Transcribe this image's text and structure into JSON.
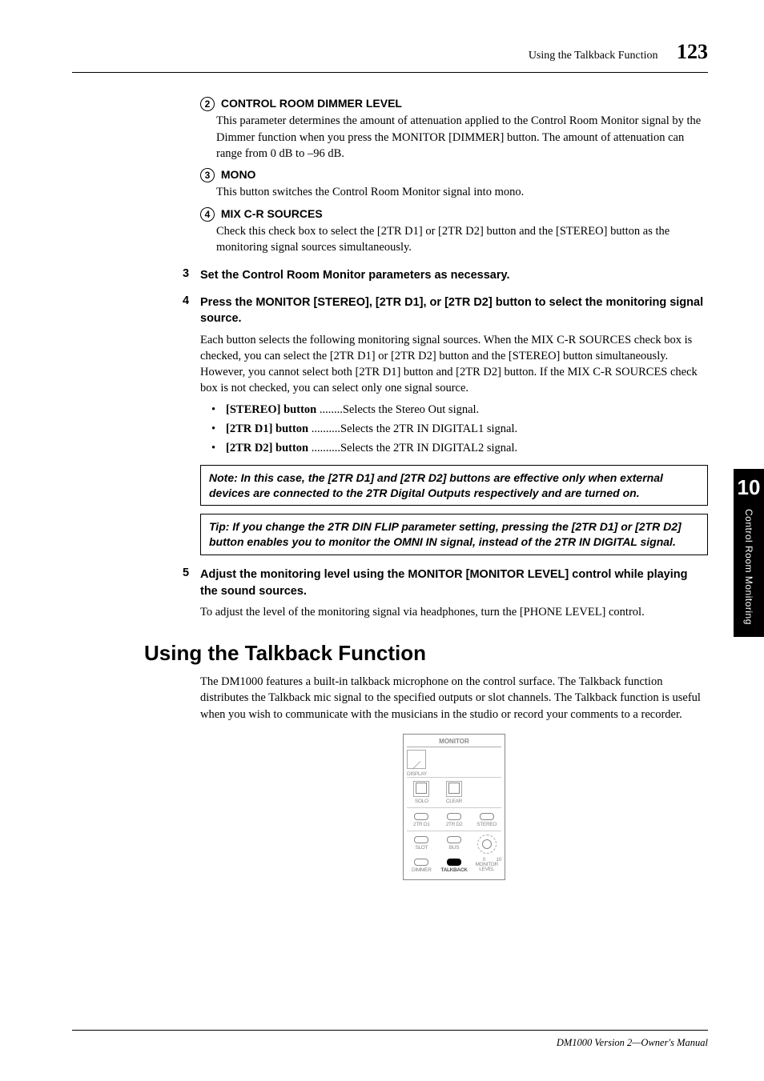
{
  "header": {
    "title": "Using the Talkback Function",
    "page": "123"
  },
  "sideTab": {
    "chapter": "10",
    "label": "Control Room Monitoring"
  },
  "params": {
    "p2": {
      "num": "2",
      "title": "CONTROL ROOM DIMMER LEVEL",
      "body": "This parameter determines the amount of attenuation applied to the Control Room Monitor signal by the Dimmer function when you press the MONITOR [DIMMER] button. The amount of attenuation can range from 0 dB to –96 dB."
    },
    "p3": {
      "num": "3",
      "title": "MONO",
      "body": "This button switches the Control Room Monitor signal into mono."
    },
    "p4": {
      "num": "4",
      "title": "MIX C-R SOURCES",
      "body": "Check this check box to select the [2TR D1] or [2TR D2] button and the [STEREO] button as the monitoring signal sources simultaneously."
    }
  },
  "steps": {
    "s3": {
      "num": "3",
      "title": "Set the Control Room Monitor parameters as necessary."
    },
    "s4": {
      "num": "4",
      "title": "Press the MONITOR [STEREO], [2TR D1], or [2TR D2] button to select the monitoring signal source.",
      "body": "Each button selects the following monitoring signal sources. When the MIX C-R SOURCES check box is checked, you can select the [2TR D1] or [2TR D2] button and the [STEREO] button simultaneously. However, you cannot select both [2TR D1] button and [2TR D2] button. If the MIX C-R SOURCES check box is not checked, you can select only one signal source.",
      "bullets": [
        {
          "label": "[STEREO] button",
          "dots": " ........",
          "desc": "Selects the Stereo Out signal."
        },
        {
          "label": "[2TR D1] button",
          "dots": " ..........",
          "desc": "Selects the 2TR IN DIGITAL1 signal."
        },
        {
          "label": "[2TR D2] button",
          "dots": " ..........",
          "desc": "Selects the 2TR IN DIGITAL2 signal."
        }
      ]
    },
    "s5": {
      "num": "5",
      "title": "Adjust the monitoring level using the MONITOR [MONITOR LEVEL] control while playing the sound sources.",
      "body": "To adjust the level of the monitoring signal via headphones, turn the [PHONE LEVEL] control."
    }
  },
  "note": {
    "label": "Note:",
    "body": "  In this case, the [2TR D1] and [2TR D2] buttons are effective only when external devices are connected to the 2TR Digital Outputs respectively and are turned on."
  },
  "tip": {
    "label": "Tip:",
    "body": "  If you change the 2TR DIN FLIP parameter setting, pressing the [2TR D1] or [2TR D2] button enables you to monitor the OMNI IN signal, instead of the 2TR IN DIGITAL signal."
  },
  "section": {
    "title": "Using the Talkback Function",
    "body": "The DM1000 features a built-in talkback microphone on the control surface. The Talkback function distributes the Talkback mic signal to the specified outputs or slot channels. The Talkback function is useful when you wish to communicate with the musicians in the studio or record your comments to a recorder."
  },
  "monitorPanel": {
    "title": "MONITOR",
    "display": "DISPLAY",
    "solo": "SOLO",
    "clear": "CLEAR",
    "d1": "2TR D1",
    "d2": "2TR D2",
    "stereo": "STEREO",
    "slot": "SLOT",
    "bus": "BUS",
    "dimmer": "DIMMER",
    "talkback": "TALKBACK",
    "level": "MONITOR LEVEL",
    "zero": "0",
    "ten": "10"
  },
  "footer": "DM1000 Version 2—Owner's Manual"
}
